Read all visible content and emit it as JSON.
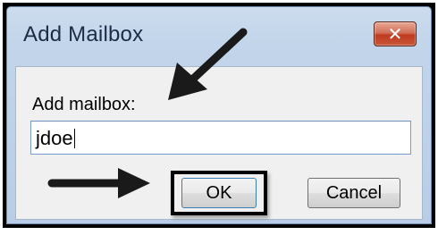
{
  "dialog": {
    "title": "Add Mailbox",
    "close_glyph": "✕",
    "field_label": "Add mailbox:",
    "field_value": "jdoe",
    "ok_label": "OK",
    "cancel_label": "Cancel"
  },
  "icons": {
    "close": "close-icon",
    "annotation_arrows": [
      "arrow-down-left-icon",
      "arrow-right-icon"
    ]
  },
  "colors": {
    "annotation": "#1a1a1a",
    "close_button": "#c9452a",
    "title_text": "#1c2c44"
  }
}
